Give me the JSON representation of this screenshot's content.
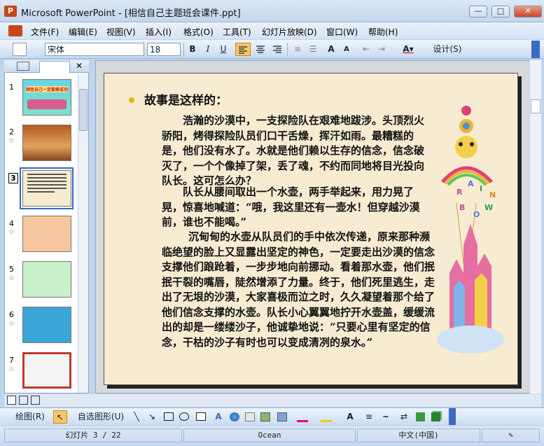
{
  "window": {
    "title": "Microsoft PowerPoint - [相信自己主题班会课件.ppt]",
    "app_icon": "P"
  },
  "window_buttons": {
    "minimize": "—",
    "maximize": "□",
    "close": "✕"
  },
  "menu": [
    "文件(F)",
    "编辑(E)",
    "视图(V)",
    "插入(I)",
    "格式(O)",
    "工具(T)",
    "幻灯片放映(D)",
    "窗口(W)",
    "帮助(H)"
  ],
  "toolbar": {
    "font_name": "宋体",
    "font_size": "18",
    "bold": "B",
    "italic": "I",
    "underline": "U",
    "design_label": "设计(S)"
  },
  "slides_pane": {
    "numbers": [
      "1",
      "2",
      "3",
      "4",
      "5",
      "6",
      "7"
    ],
    "slide1_caption": "相信自己一定能够成功"
  },
  "slide": {
    "heading": "故事是这样的：",
    "p1": "浩瀚的沙漠中，一支探险队在艰难地跋涉。头顶烈火骄阳，烤得探险队员们口干舌燥，挥汗如雨。最糟糕的是，他们没有水了。水就是他们赖以生存的信念，信念破灭了，一个个像掉了架，丢了魂，不约而同地将目光投向队长。这可怎么办？",
    "p2": "队长从腰间取出一个水壶，两手举起来，用力晃了晃，惊喜地喊道：“哦，我这里还有一壶水！但穿越沙漠前，谁也不能喝。”",
    "p3": "沉甸甸的水壶从队员们的手中依次传递，原来那种濒临绝望的脸上又显露出坚定的神色，一定要走出沙漠的信念支撑他们踉跄着，一步步地向前挪动。看着那水壶，他们抿抿干裂的嘴唇，陡然增添了力量。终于，他们死里逃生，走出了无垠的沙漠，大家喜极而泣之时，久久凝望着那个给了他们信念支撑的水壶。队长小心翼翼地拧开水壶盖，缓缓流出的却是一缕缕沙子，他诚挚地说：“只要心里有坚定的信念，干枯的沙子有时也可以变成清冽的泉水。”",
    "rainbow_letters": [
      "R",
      "A",
      "I",
      "N",
      "B",
      "O",
      "W"
    ]
  },
  "drawing_toolbar": {
    "draw_label": "绘图(R)",
    "autoshapes_label": "自选图形(U)"
  },
  "status": {
    "slide_counter": "幻灯片 3 / 22",
    "theme": "Ocean",
    "language": "中文(中国)"
  },
  "colors": {
    "slide_bg": "#f7ecd2",
    "accent": "#316ac5",
    "bullet": "#e6b800"
  }
}
